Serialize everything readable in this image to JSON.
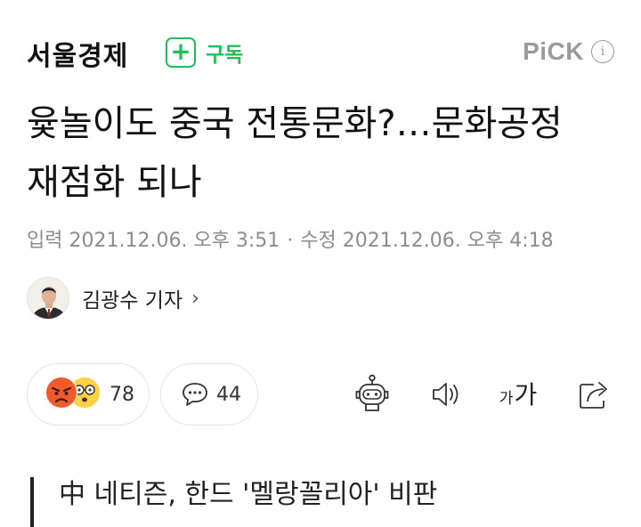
{
  "header": {
    "press_name": "서울경제",
    "subscribe_label": "구독",
    "pick_label": "PiCK",
    "info_symbol": "i"
  },
  "article": {
    "title": "윷놀이도 중국 전통문화?…문화공정 재점화 되나",
    "input_date": "입력 2021.12.06. 오후 3:51",
    "separator": "·",
    "modified_date": "수정 2021.12.06. 오후 4:18",
    "author": "김광수 기자",
    "author_chevron": "›",
    "subtitle": "中 네티즌, 한드 '멜랑꼴리아' 비판"
  },
  "actions": {
    "reaction_count": "78",
    "comment_count": "44",
    "font_small": "가",
    "font_big": "가"
  },
  "icons": [
    "plus-icon",
    "info-icon",
    "angry-emoji-icon",
    "surprised-emoji-icon",
    "comment-icon",
    "robot-summary-icon",
    "speaker-icon",
    "share-icon"
  ],
  "colors": {
    "accent_green": "#1fbf55",
    "muted_gray": "#8c8c8c"
  }
}
